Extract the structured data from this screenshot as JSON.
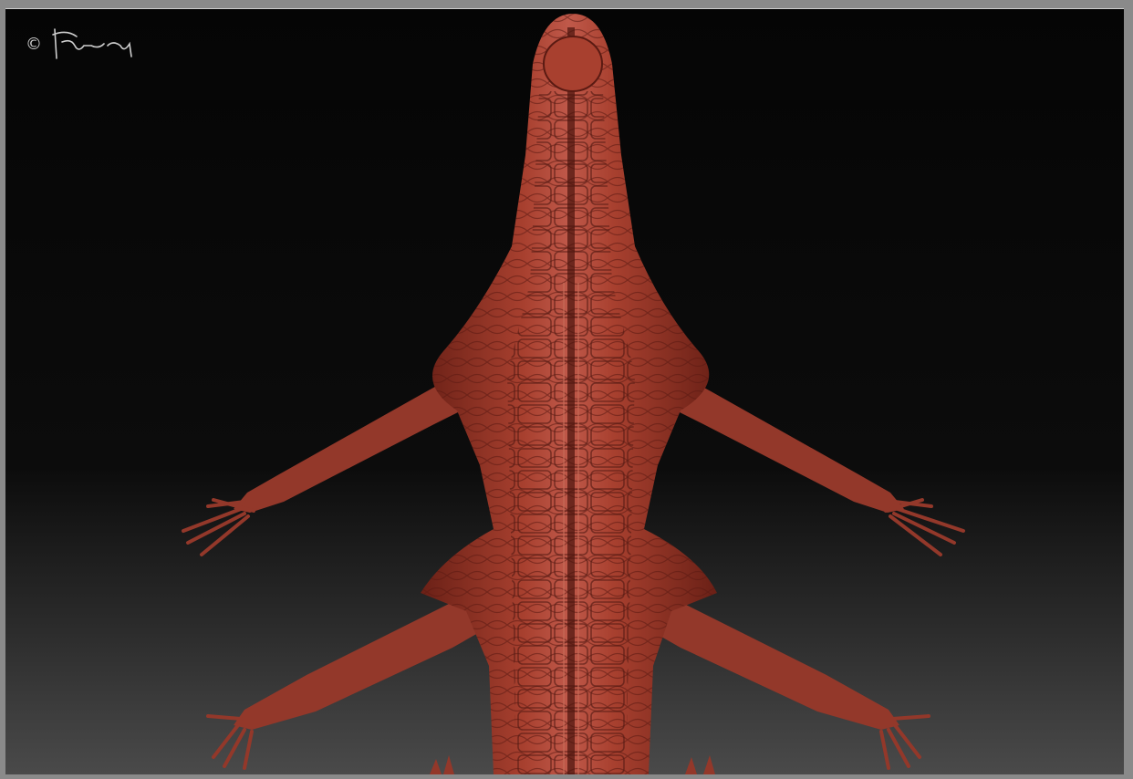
{
  "image": {
    "subject": "lizard-creature-sculpt",
    "colors": {
      "background_top": "#050505",
      "background_bottom": "#4a4a4a",
      "skin": "#9a3a2c",
      "skin_shadow": "#5e1c14",
      "skin_highlight": "#c2604c",
      "frame": "#8a8a8a",
      "signature": "#cfcfcf"
    }
  },
  "signature": {
    "symbol": "©",
    "handwriting": "Fatinrop"
  }
}
